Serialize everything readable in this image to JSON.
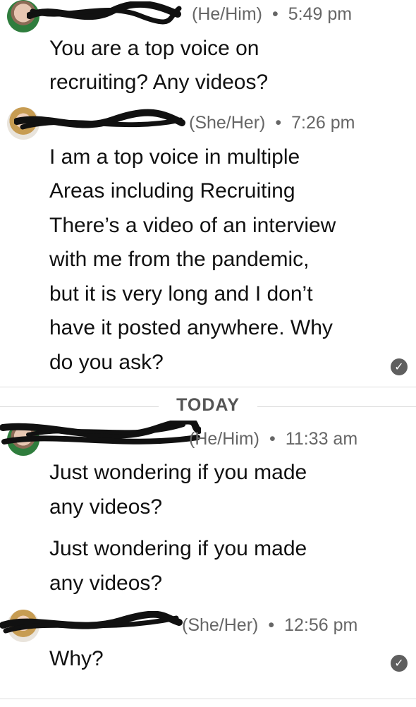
{
  "messages": [
    {
      "author_redacted": true,
      "pronouns": "(He/Him)",
      "time": "5:49 pm",
      "lines": [
        "You are a top voice on",
        "recruiting? Any videos?"
      ]
    },
    {
      "author_redacted": true,
      "pronouns": "(She/Her)",
      "time": "7:26 pm",
      "lines": [
        "I am a top voice in multiple",
        "Areas including Recruiting",
        "There’s a video of an interview",
        "with me from the pandemic,",
        "but it is very long and I don’t",
        "have it posted anywhere. Why",
        "do you ask?"
      ],
      "read_receipt": "check-icon"
    },
    {
      "author_redacted": true,
      "pronouns": "(He/Him)",
      "time": "11:33 am",
      "lines": [
        "Just wondering if you made",
        "any videos?",
        "Just wondering if you made",
        "any videos?"
      ]
    },
    {
      "author_redacted": true,
      "pronouns": "(She/Her)",
      "time": "12:56 pm",
      "lines": [
        "Why?"
      ],
      "read_receipt": "check-icon"
    }
  ],
  "separator": {
    "label": "TODAY"
  },
  "colors": {
    "text": "#111111",
    "meta": "#666666",
    "divider": "#dddddd",
    "check": "#5f5f5f"
  }
}
